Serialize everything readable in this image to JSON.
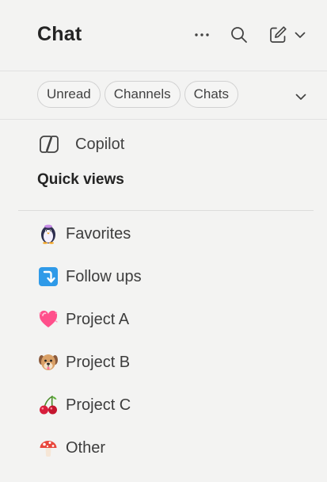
{
  "header": {
    "title": "Chat",
    "more_icon": "more-horizontal-icon",
    "search_icon": "search-icon",
    "compose_icon": "compose-icon",
    "compose_chevron_icon": "chevron-down-icon"
  },
  "filters": {
    "pills": [
      {
        "label": "Unread"
      },
      {
        "label": "Channels"
      },
      {
        "label": "Chats"
      }
    ],
    "toggle_icon": "chevron-down-icon"
  },
  "copilot": {
    "label": "Copilot",
    "icon": "copilot-icon"
  },
  "quick_views": {
    "title": "Quick views",
    "items": [
      {
        "label": "Favorites",
        "icon": "penguin-icon"
      },
      {
        "label": "Follow ups",
        "icon": "follow-up-arrow-icon"
      },
      {
        "label": "Project A",
        "icon": "heart-icon"
      },
      {
        "label": "Project B",
        "icon": "dog-icon"
      },
      {
        "label": "Project C",
        "icon": "cherries-icon"
      },
      {
        "label": "Other",
        "icon": "mushroom-icon"
      }
    ]
  },
  "colors": {
    "background": "#f3f3f2",
    "text_primary": "#242424",
    "text_secondary": "#424242",
    "divider": "#e1e1e1"
  }
}
